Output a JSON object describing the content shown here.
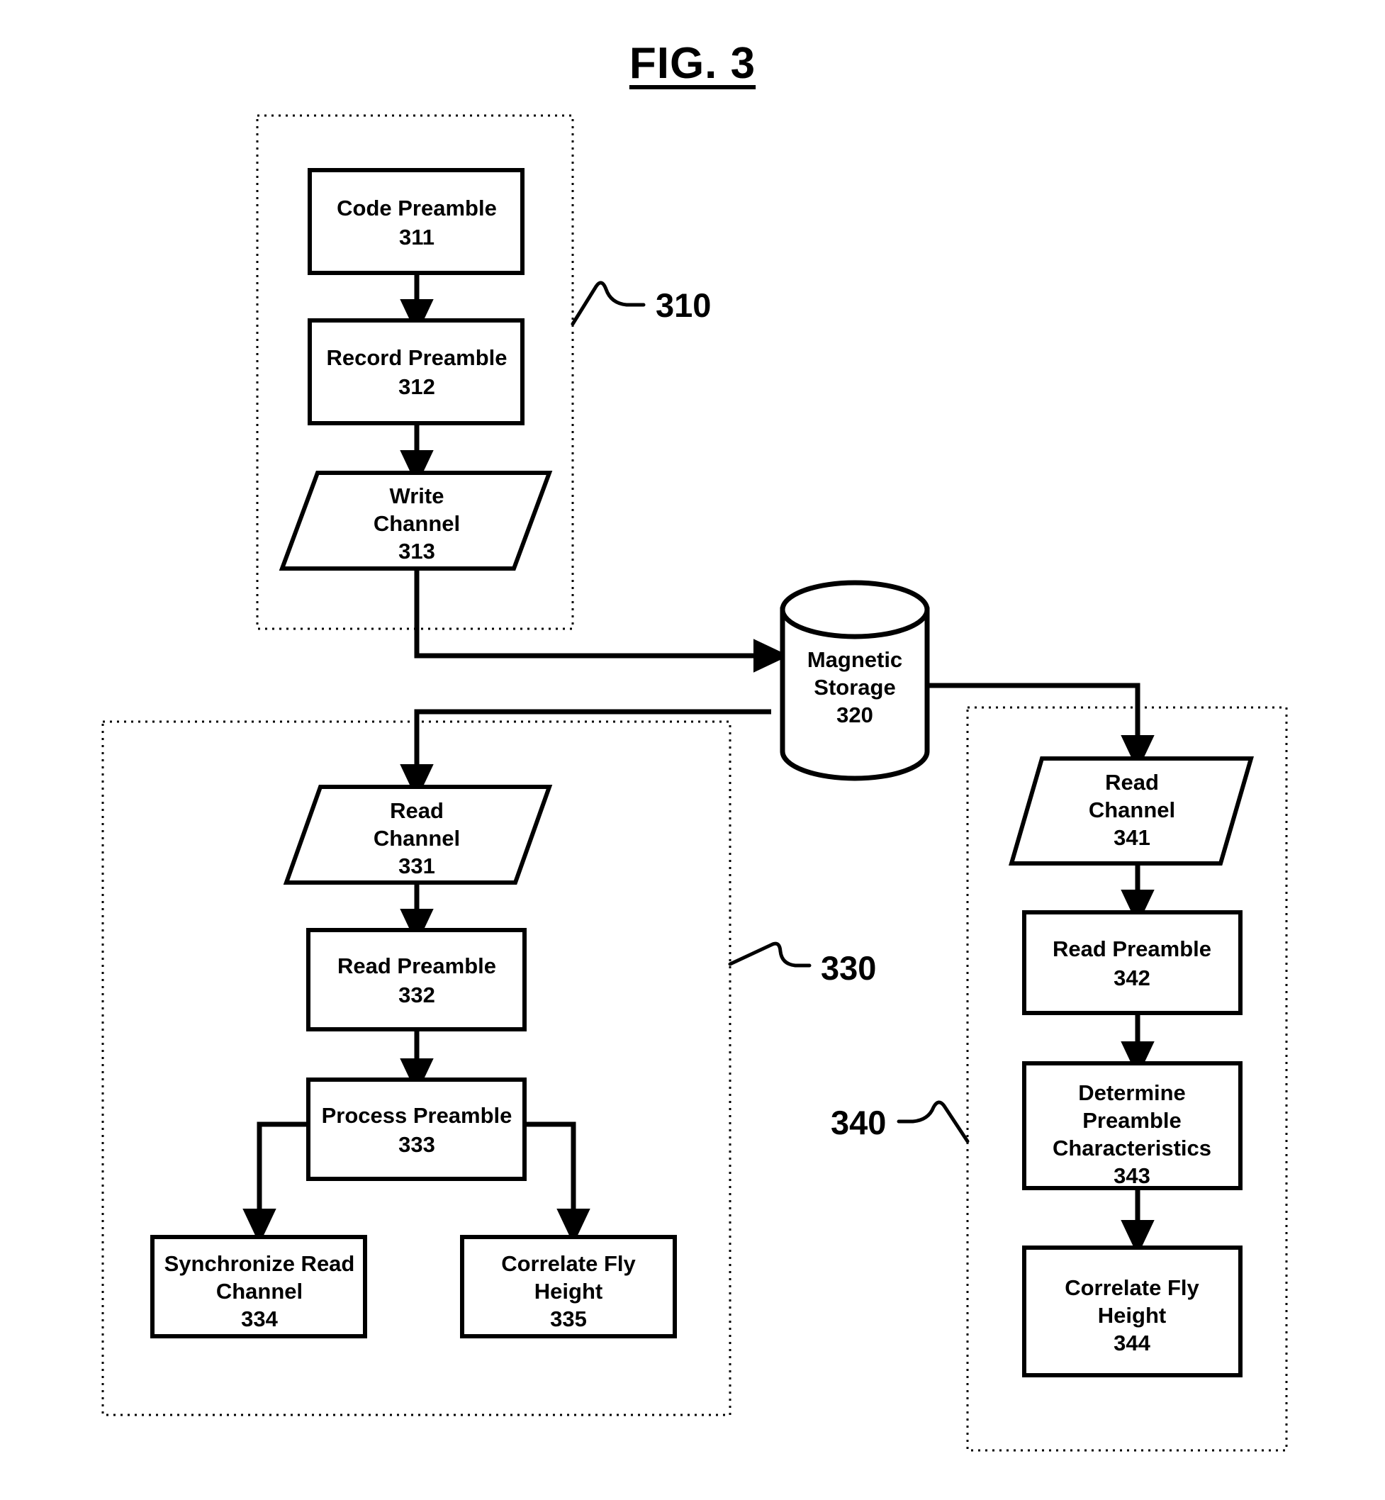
{
  "figure": {
    "title": "FIG. 3"
  },
  "groups": [
    {
      "id": "g310",
      "ref": "310"
    },
    {
      "id": "g330",
      "ref": "330"
    },
    {
      "id": "g340",
      "ref": "340"
    }
  ],
  "nodes": {
    "code_preamble": {
      "lines": [
        "Code Preamble",
        "311"
      ],
      "shape": "rect"
    },
    "record_preamble": {
      "lines": [
        "Record Preamble",
        "312"
      ],
      "shape": "rect"
    },
    "write_channel": {
      "lines": [
        "Write",
        "Channel",
        "313"
      ],
      "shape": "parallelogram"
    },
    "magnetic_storage": {
      "lines": [
        "Magnetic",
        "Storage",
        "320"
      ],
      "shape": "cylinder"
    },
    "read_channel_331": {
      "lines": [
        "Read",
        "Channel",
        "331"
      ],
      "shape": "parallelogram"
    },
    "read_preamble_332": {
      "lines": [
        "Read Preamble",
        "332"
      ],
      "shape": "rect"
    },
    "process_preamble_333": {
      "lines": [
        "Process Preamble",
        "333"
      ],
      "shape": "rect"
    },
    "synchronize_read_channel_334": {
      "lines": [
        "Synchronize Read",
        "Channel",
        "334"
      ],
      "shape": "rect"
    },
    "correlate_fly_height_335": {
      "lines": [
        "Correlate Fly",
        "Height",
        "335"
      ],
      "shape": "rect"
    },
    "read_channel_341": {
      "lines": [
        "Read",
        "Channel",
        "341"
      ],
      "shape": "parallelogram"
    },
    "read_preamble_342": {
      "lines": [
        "Read Preamble",
        "342"
      ],
      "shape": "rect"
    },
    "determine_preamble_characteristics_343": {
      "lines": [
        "Determine",
        "Preamble",
        "Characteristics",
        "343"
      ],
      "shape": "rect"
    },
    "correlate_fly_height_344": {
      "lines": [
        "Correlate Fly",
        "Height",
        "344"
      ],
      "shape": "rect"
    }
  },
  "edges": [
    {
      "from": "code_preamble",
      "to": "record_preamble"
    },
    {
      "from": "record_preamble",
      "to": "write_channel"
    },
    {
      "from": "write_channel",
      "to": "magnetic_storage"
    },
    {
      "from": "magnetic_storage",
      "to": "read_channel_331"
    },
    {
      "from": "read_channel_331",
      "to": "read_preamble_332"
    },
    {
      "from": "read_preamble_332",
      "to": "process_preamble_333"
    },
    {
      "from": "process_preamble_333",
      "to": "synchronize_read_channel_334"
    },
    {
      "from": "process_preamble_333",
      "to": "correlate_fly_height_335"
    },
    {
      "from": "magnetic_storage",
      "to": "read_channel_341"
    },
    {
      "from": "read_channel_341",
      "to": "read_preamble_342"
    },
    {
      "from": "read_preamble_342",
      "to": "determine_preamble_characteristics_343"
    },
    {
      "from": "determine_preamble_characteristics_343",
      "to": "correlate_fly_height_344"
    }
  ],
  "colors": {
    "stroke": "#000000",
    "background": "#ffffff"
  }
}
